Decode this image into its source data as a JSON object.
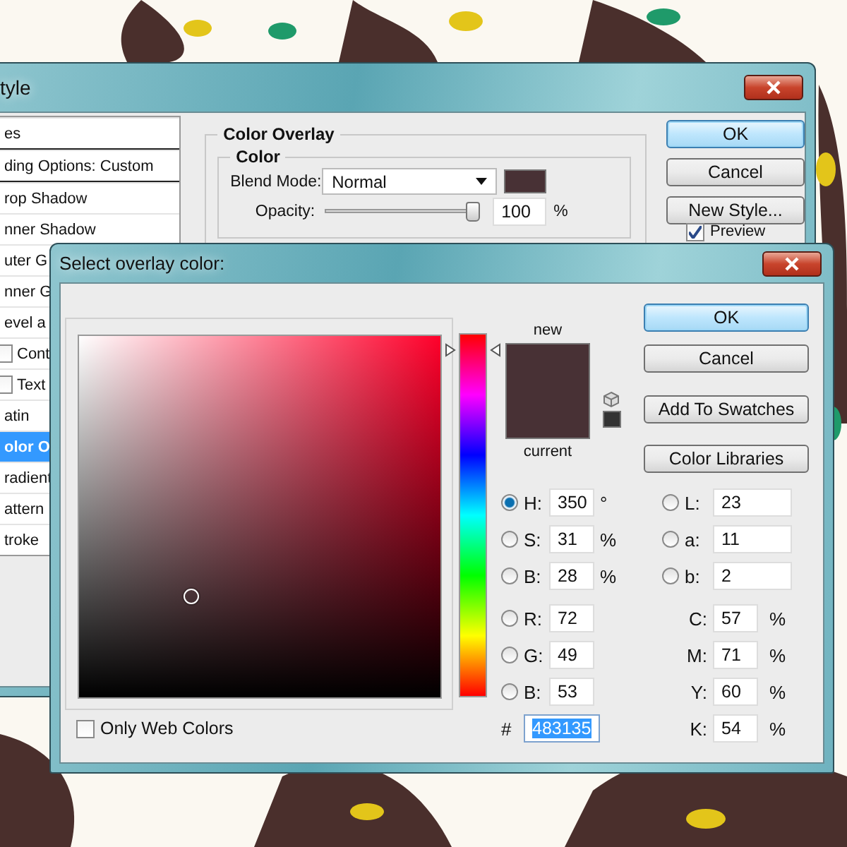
{
  "layer_style": {
    "title": "tyle",
    "styles": [
      {
        "label": "es",
        "kind": "header",
        "selected": false
      },
      {
        "label": "ding Options: Custom",
        "kind": "header",
        "selected": false
      },
      {
        "label": "rop Shadow",
        "kind": "plain",
        "selected": false
      },
      {
        "label": "nner Shadow",
        "kind": "plain",
        "selected": false
      },
      {
        "label": "uter G",
        "kind": "plain",
        "selected": false
      },
      {
        "label": "nner G",
        "kind": "plain",
        "selected": false
      },
      {
        "label": "evel a",
        "kind": "plain",
        "selected": false
      },
      {
        "label": "Cont",
        "kind": "checkbox",
        "checked": false,
        "selected": false
      },
      {
        "label": "Text",
        "kind": "checkbox",
        "checked": false,
        "selected": false
      },
      {
        "label": "atin",
        "kind": "plain",
        "selected": false
      },
      {
        "label": "olor O",
        "kind": "plain",
        "selected": true
      },
      {
        "label": "radient",
        "kind": "plain",
        "selected": false
      },
      {
        "label": "attern",
        "kind": "plain",
        "selected": false
      },
      {
        "label": "troke",
        "kind": "plain",
        "selected": false
      }
    ],
    "section_title": "Color Overlay",
    "group_title": "Color",
    "blend_mode": {
      "label": "Blend Mode:",
      "value": "Normal"
    },
    "opacity": {
      "label": "Opacity:",
      "level": 1.0,
      "value": "100",
      "unit": "%"
    },
    "buttons": [
      {
        "label": "OK",
        "default": true
      },
      {
        "label": "Cancel",
        "default": false
      },
      {
        "label": "New Style...",
        "default": false
      }
    ],
    "preview": {
      "label": "Preview",
      "checked": true
    }
  },
  "color_picker": {
    "title": "Select overlay color:",
    "new_label": "new",
    "current_label": "current",
    "buttons": [
      {
        "label": "OK",
        "default": true
      },
      {
        "label": "Cancel",
        "default": false
      },
      {
        "label": "Add To Swatches",
        "default": false
      },
      {
        "label": "Color Libraries",
        "default": false
      }
    ],
    "hue": {
      "level": 0.97
    },
    "left_fields": [
      {
        "kind": "radio",
        "label": "H:",
        "value": "350",
        "unit": "°",
        "selected": true
      },
      {
        "kind": "radio",
        "label": "S:",
        "value": "31",
        "unit": "%",
        "selected": false
      },
      {
        "kind": "radio",
        "label": "B:",
        "value": "28",
        "unit": "%",
        "selected": false
      },
      {
        "kind": "radio",
        "label": "R:",
        "value": "72",
        "selected": false
      },
      {
        "kind": "radio",
        "label": "G:",
        "value": "49",
        "selected": false
      },
      {
        "kind": "radio",
        "label": "B:",
        "value": "53",
        "selected": false
      }
    ],
    "hex": {
      "label": "#",
      "value": "483135"
    },
    "right_fields": [
      {
        "kind": "radio",
        "label": "L:",
        "value": "23",
        "selected": false
      },
      {
        "kind": "radio",
        "label": "a:",
        "value": "11",
        "selected": false
      },
      {
        "kind": "radio",
        "label": "b:",
        "value": "2",
        "selected": false
      },
      {
        "kind": "plain",
        "label": "C:",
        "value": "57",
        "unit": "%"
      },
      {
        "kind": "plain",
        "label": "M:",
        "value": "71",
        "unit": "%"
      },
      {
        "kind": "plain",
        "label": "Y:",
        "value": "60",
        "unit": "%"
      },
      {
        "kind": "plain",
        "label": "K:",
        "value": "54",
        "unit": "%"
      }
    ],
    "web_colors": {
      "label": "Only Web Colors",
      "checked": false
    }
  }
}
